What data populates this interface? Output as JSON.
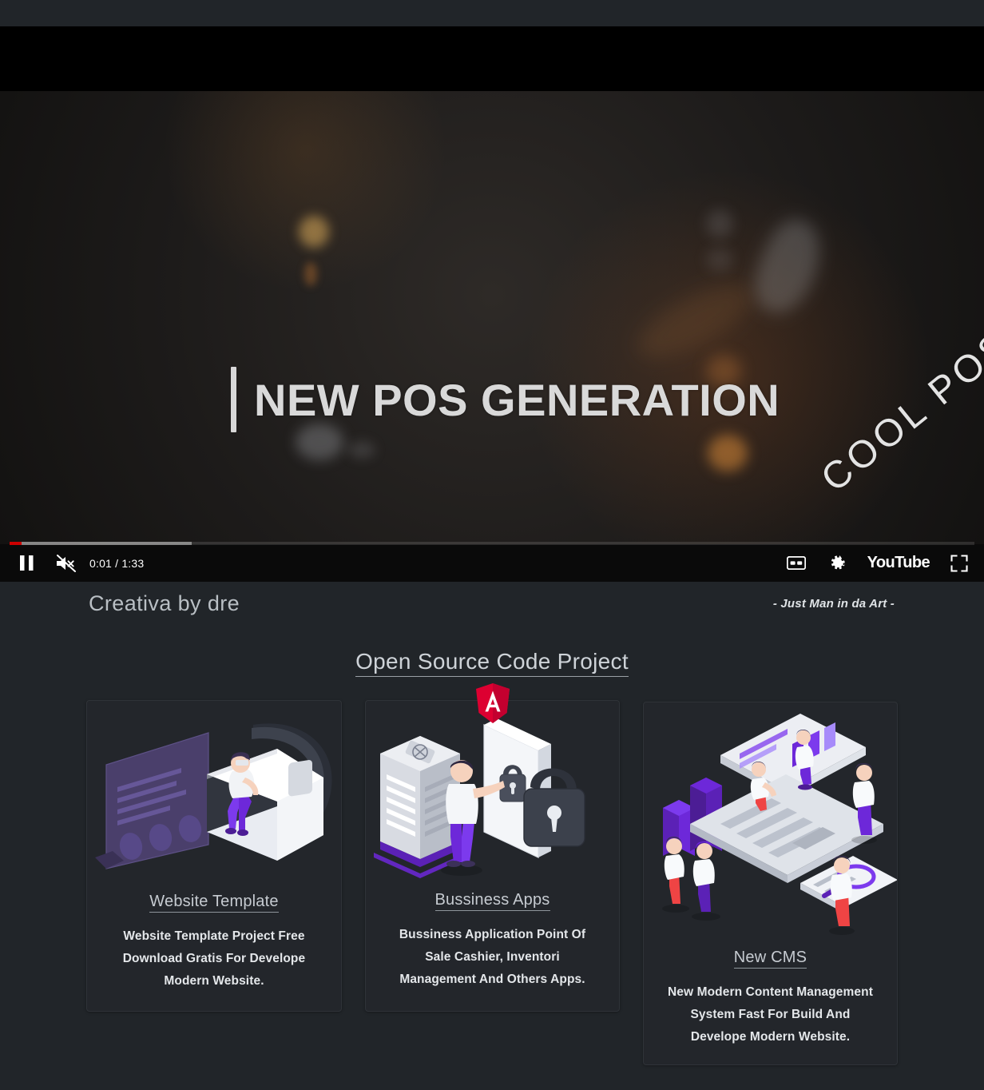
{
  "player": {
    "video_title": "NEW POS GENERATION",
    "corner_watermark": "COOL POS",
    "time_display": "0:01 / 1:33",
    "progress": {
      "played_percent": 1,
      "buffered_percent": 19
    },
    "controls": {
      "pause_label": "Pause",
      "mute_label": "Unmute (muted)",
      "captions_label": "Subtitles/closed captions",
      "settings_label": "Settings",
      "watch_label": "YouTube",
      "fullscreen_label": "Full screen"
    },
    "icons": {
      "pause": "pause-icon",
      "mute": "volume-muted-icon",
      "captions": "closed-captions-icon",
      "settings": "gear-icon",
      "fullscreen": "fullscreen-icon"
    }
  },
  "header": {
    "brand": "Creativa by dre",
    "tagline": "- Just Man in da Art -"
  },
  "section": {
    "heading": "Open Source Code Project"
  },
  "cards": [
    {
      "id": "website-template",
      "title": "Website Template",
      "description": "Website Template Project Free Download Gratis For Develope Modern Website.",
      "art": "vr-headset-illustration"
    },
    {
      "id": "bussiness-apps",
      "title": "Bussiness Apps",
      "description": "Bussiness Application Point Of Sale Cashier, Inventori Management And Others Apps.",
      "art": "mobile-security-illustration",
      "badge": "angular-logo"
    },
    {
      "id": "new-cms",
      "title": "New CMS",
      "description": "New Modern Content Management System Fast For Build And Develope Modern Website.",
      "art": "laptop-dashboard-illustration"
    }
  ],
  "colors": {
    "page_background": "#212529",
    "card_background": "#23262b",
    "card_border": "#2f3338",
    "player_background": "#000000",
    "progress_played": "#cc0000",
    "angular_red": "#dd0031",
    "accent_purple": "#6b46c1",
    "text_primary": "#e4e7ea",
    "text_muted": "#b9bfc4"
  }
}
